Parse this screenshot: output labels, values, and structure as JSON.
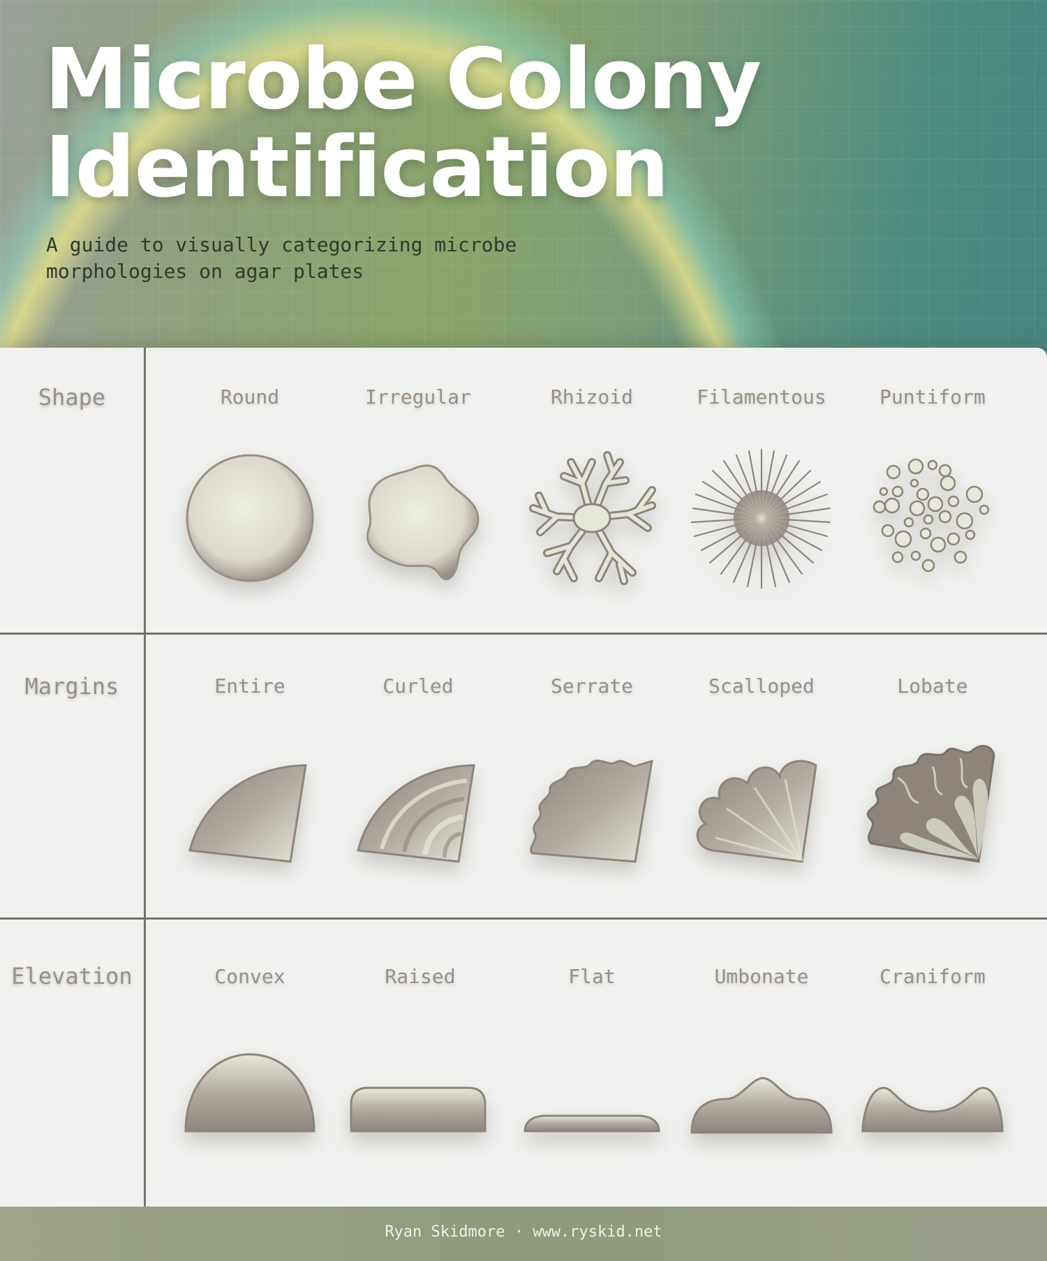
{
  "header": {
    "title_line1": "Microbe Colony",
    "title_line2": "Identification",
    "subtitle": "A guide to visually categorizing microbe morphologies on agar plates"
  },
  "rows": [
    {
      "label": "Shape",
      "items": [
        {
          "label": "Round",
          "icon": "round-colony-icon"
        },
        {
          "label": "Irregular",
          "icon": "irregular-colony-icon"
        },
        {
          "label": "Rhizoid",
          "icon": "rhizoid-colony-icon"
        },
        {
          "label": "Filamentous",
          "icon": "filamentous-colony-icon"
        },
        {
          "label": "Puntiform",
          "icon": "puntiform-colony-icon"
        }
      ]
    },
    {
      "label": "Margins",
      "items": [
        {
          "label": "Entire",
          "icon": "entire-margin-icon"
        },
        {
          "label": "Curled",
          "icon": "curled-margin-icon"
        },
        {
          "label": "Serrate",
          "icon": "serrate-margin-icon"
        },
        {
          "label": "Scalloped",
          "icon": "scalloped-margin-icon"
        },
        {
          "label": "Lobate",
          "icon": "lobate-margin-icon"
        }
      ]
    },
    {
      "label": "Elevation",
      "items": [
        {
          "label": "Convex",
          "icon": "convex-elevation-icon"
        },
        {
          "label": "Raised",
          "icon": "raised-elevation-icon"
        },
        {
          "label": "Flat",
          "icon": "flat-elevation-icon"
        },
        {
          "label": "Umbonate",
          "icon": "umbonate-elevation-icon"
        },
        {
          "label": "Craniform",
          "icon": "craniform-elevation-icon"
        }
      ]
    }
  ],
  "footer": {
    "credit": "Ryan Skidmore · www.ryskid.net"
  },
  "colors": {
    "colony_light": "#e8eadb",
    "colony_dark": "#8e847c",
    "divider": "#6f7764",
    "label_text": "#9a8f86"
  }
}
